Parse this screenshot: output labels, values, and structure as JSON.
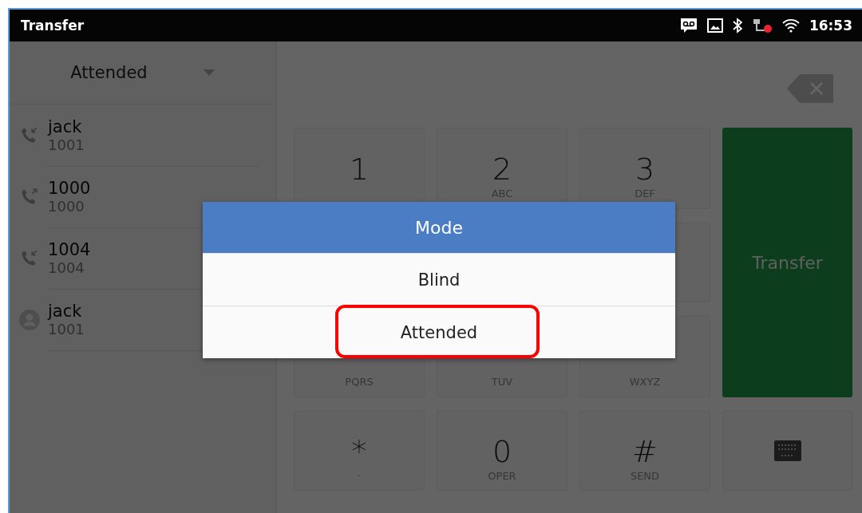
{
  "status_bar": {
    "title": "Transfer",
    "time": "16:53"
  },
  "mode_dropdown": {
    "value": "Attended"
  },
  "contacts": [
    {
      "name": "jack",
      "number": "1001",
      "kind": "incoming"
    },
    {
      "name": "1000",
      "number": "1000",
      "kind": "outgoing"
    },
    {
      "name": "1004",
      "number": "1004",
      "kind": "incoming"
    },
    {
      "name": "jack",
      "number": "1001",
      "kind": "contact"
    }
  ],
  "keypad": [
    {
      "digit": "1"
    },
    {
      "digit": "2",
      "letters": "ABC"
    },
    {
      "digit": "3",
      "letters": "DEF"
    },
    {
      "letters": "PQRS"
    },
    {
      "letters": "TUV"
    },
    {
      "letters": "WXYZ"
    },
    {
      "digit": "*",
      "letters": "·"
    },
    {
      "digit": "0",
      "letters": "OPER"
    },
    {
      "digit": "#",
      "letters": "SEND"
    }
  ],
  "transfer_button": "Transfer",
  "dialog": {
    "title": "Mode",
    "options": [
      {
        "label": "Blind",
        "highlighted": false
      },
      {
        "label": "Attended",
        "highlighted": true
      }
    ]
  }
}
